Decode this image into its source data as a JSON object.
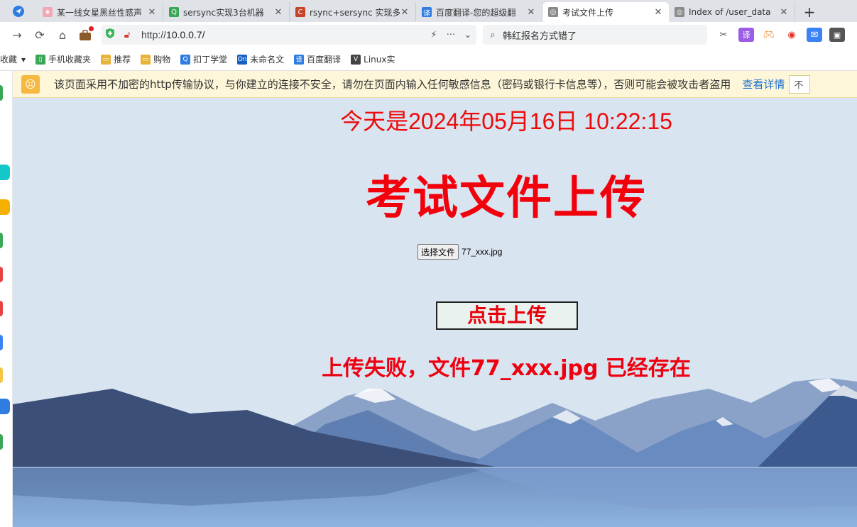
{
  "tabs": [
    {
      "title": "某一线女星黑丝性感声",
      "color": "#f3a6b4",
      "glyph": "★",
      "active": false
    },
    {
      "title": "sersync实现3台机器",
      "color": "#3aa756",
      "glyph": "Q",
      "active": false
    },
    {
      "title": "rsync+sersync 实现多",
      "color": "#c9432a",
      "glyph": "C",
      "active": false
    },
    {
      "title": "百度翻译-您的超级翻",
      "color": "#2f7de1",
      "glyph": "译",
      "active": false
    },
    {
      "title": "考试文件上传",
      "color": "#8a8a8a",
      "glyph": "◎",
      "active": true
    },
    {
      "title": "Index of /user_data",
      "color": "#8a8a8a",
      "glyph": "◎",
      "active": false
    }
  ],
  "nav": {
    "url_prefix": "http://",
    "url_host": "10.0.0.7/",
    "search_text": "韩红报名方式错了"
  },
  "bookmarks": [
    {
      "label": "收藏",
      "glyph": "",
      "color": ""
    },
    {
      "label": "手机收藏夹",
      "glyph": "▯",
      "color": "#3aa756"
    },
    {
      "label": "推荐",
      "glyph": "▭",
      "color": "#e8b339"
    },
    {
      "label": "购物",
      "glyph": "▭",
      "color": "#e8b339"
    },
    {
      "label": "扣丁学堂",
      "glyph": "Q",
      "color": "#2f7de1"
    },
    {
      "label": "未命名文",
      "glyph": "On",
      "color": "#1760c4"
    },
    {
      "label": "百度翻译",
      "glyph": "译",
      "color": "#2f7de1"
    },
    {
      "label": "Linux实",
      "glyph": "V",
      "color": "#444444"
    }
  ],
  "warning": {
    "text": "该页面采用不加密的http传输协议，与你建立的连接不安全，请勿在页面内输入任何敏感信息（密码或银行卡信息等），否则可能会被攻击者盗用",
    "link": "查看详情",
    "button": "不"
  },
  "page": {
    "clock": "今天是2024年05月16日 10:22:15",
    "title": "考试文件上传",
    "file_button": "选择文件",
    "file_name": "77_xxx.jpg",
    "upload_button": "点击上传",
    "result": "上传失败，文件77_xxx.jpg 已经存在"
  },
  "colors": {
    "accent_red": "#f2000c",
    "page_bg": "#d8e4f0",
    "link": "#1f6fd1"
  }
}
